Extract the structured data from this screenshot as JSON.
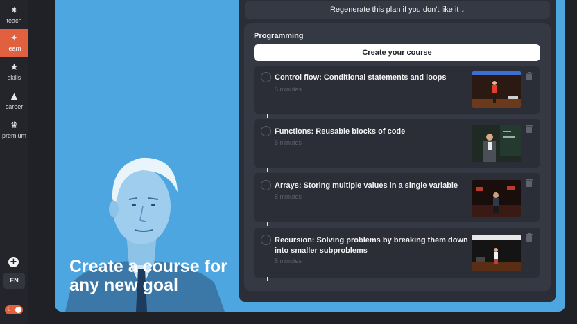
{
  "sidebar": {
    "items": [
      {
        "label": "teach",
        "icon": "sparkle-icon",
        "glyph": "✷"
      },
      {
        "label": "learn",
        "icon": "four-point-star-icon",
        "glyph": "✦"
      },
      {
        "label": "skills",
        "icon": "star-icon",
        "glyph": "★"
      },
      {
        "label": "career",
        "icon": "triangle-icon",
        "glyph": "▲"
      },
      {
        "label": "premium",
        "icon": "crown-icon",
        "glyph": "♛"
      }
    ],
    "active_index": 1,
    "add_glyph": "+",
    "language": "EN",
    "theme_glyph": "☾"
  },
  "hero": {
    "title": "Create a course for any new goal"
  },
  "plan": {
    "regenerate_label": "Regenerate this plan if you don't like it ↓",
    "course_title": "Programming",
    "create_label": "Create your course",
    "lessons": [
      {
        "title": "Control flow: Conditional statements and loops",
        "duration": "5 minutes"
      },
      {
        "title": "Functions: Reusable blocks of code",
        "duration": "5 minutes"
      },
      {
        "title": "Arrays: Storing multiple values in a single variable",
        "duration": "5 minutes"
      },
      {
        "title": "Recursion: Solving problems by breaking them down into smaller subproblems",
        "duration": "5 minutes"
      }
    ]
  },
  "colors": {
    "accent": "#e0603f",
    "canvas_blue": "#4da6e0",
    "panel": "#2b2e36",
    "card": "#353943"
  }
}
